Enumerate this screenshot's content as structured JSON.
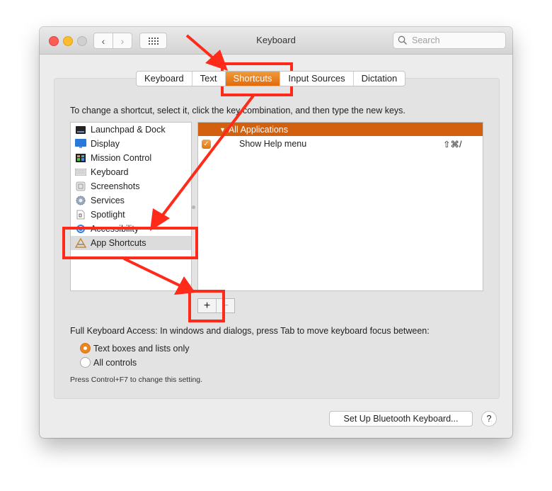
{
  "window": {
    "title": "Keyboard",
    "search_placeholder": "Search"
  },
  "tabs": [
    {
      "label": "Keyboard",
      "active": false
    },
    {
      "label": "Text",
      "active": false
    },
    {
      "label": "Shortcuts",
      "active": true
    },
    {
      "label": "Input Sources",
      "active": false
    },
    {
      "label": "Dictation",
      "active": false
    }
  ],
  "instruction": "To change a shortcut, select it, click the key combination, and then type the new keys.",
  "categories": [
    {
      "label": "Launchpad & Dock",
      "icon": "launchpad-dock-icon"
    },
    {
      "label": "Display",
      "icon": "display-icon"
    },
    {
      "label": "Mission Control",
      "icon": "mission-control-icon"
    },
    {
      "label": "Keyboard",
      "icon": "keyboard-icon"
    },
    {
      "label": "Screenshots",
      "icon": "screenshots-icon"
    },
    {
      "label": "Services",
      "icon": "services-gear-icon"
    },
    {
      "label": "Spotlight",
      "icon": "spotlight-icon"
    },
    {
      "label": "Accessibility",
      "icon": "accessibility-icon"
    },
    {
      "label": "App Shortcuts",
      "icon": "app-shortcuts-icon",
      "selected": true
    }
  ],
  "shortcuts": {
    "group_label": "All Applications",
    "rows": [
      {
        "name": "Show Help menu",
        "keys": "⇧⌘/",
        "checked": true
      }
    ]
  },
  "add_button": "+",
  "remove_button": "−",
  "full_keyboard_access": {
    "label": "Full Keyboard Access: In windows and dialogs, press Tab to move keyboard focus between:",
    "options": [
      {
        "label": "Text boxes and lists only",
        "selected": true
      },
      {
        "label": "All controls",
        "selected": false
      }
    ],
    "hint": "Press Control+F7 to change this setting."
  },
  "bluetooth_button": "Set Up Bluetooth Keyboard...",
  "help_button": "?",
  "annotation_color": "#ff2a1a"
}
